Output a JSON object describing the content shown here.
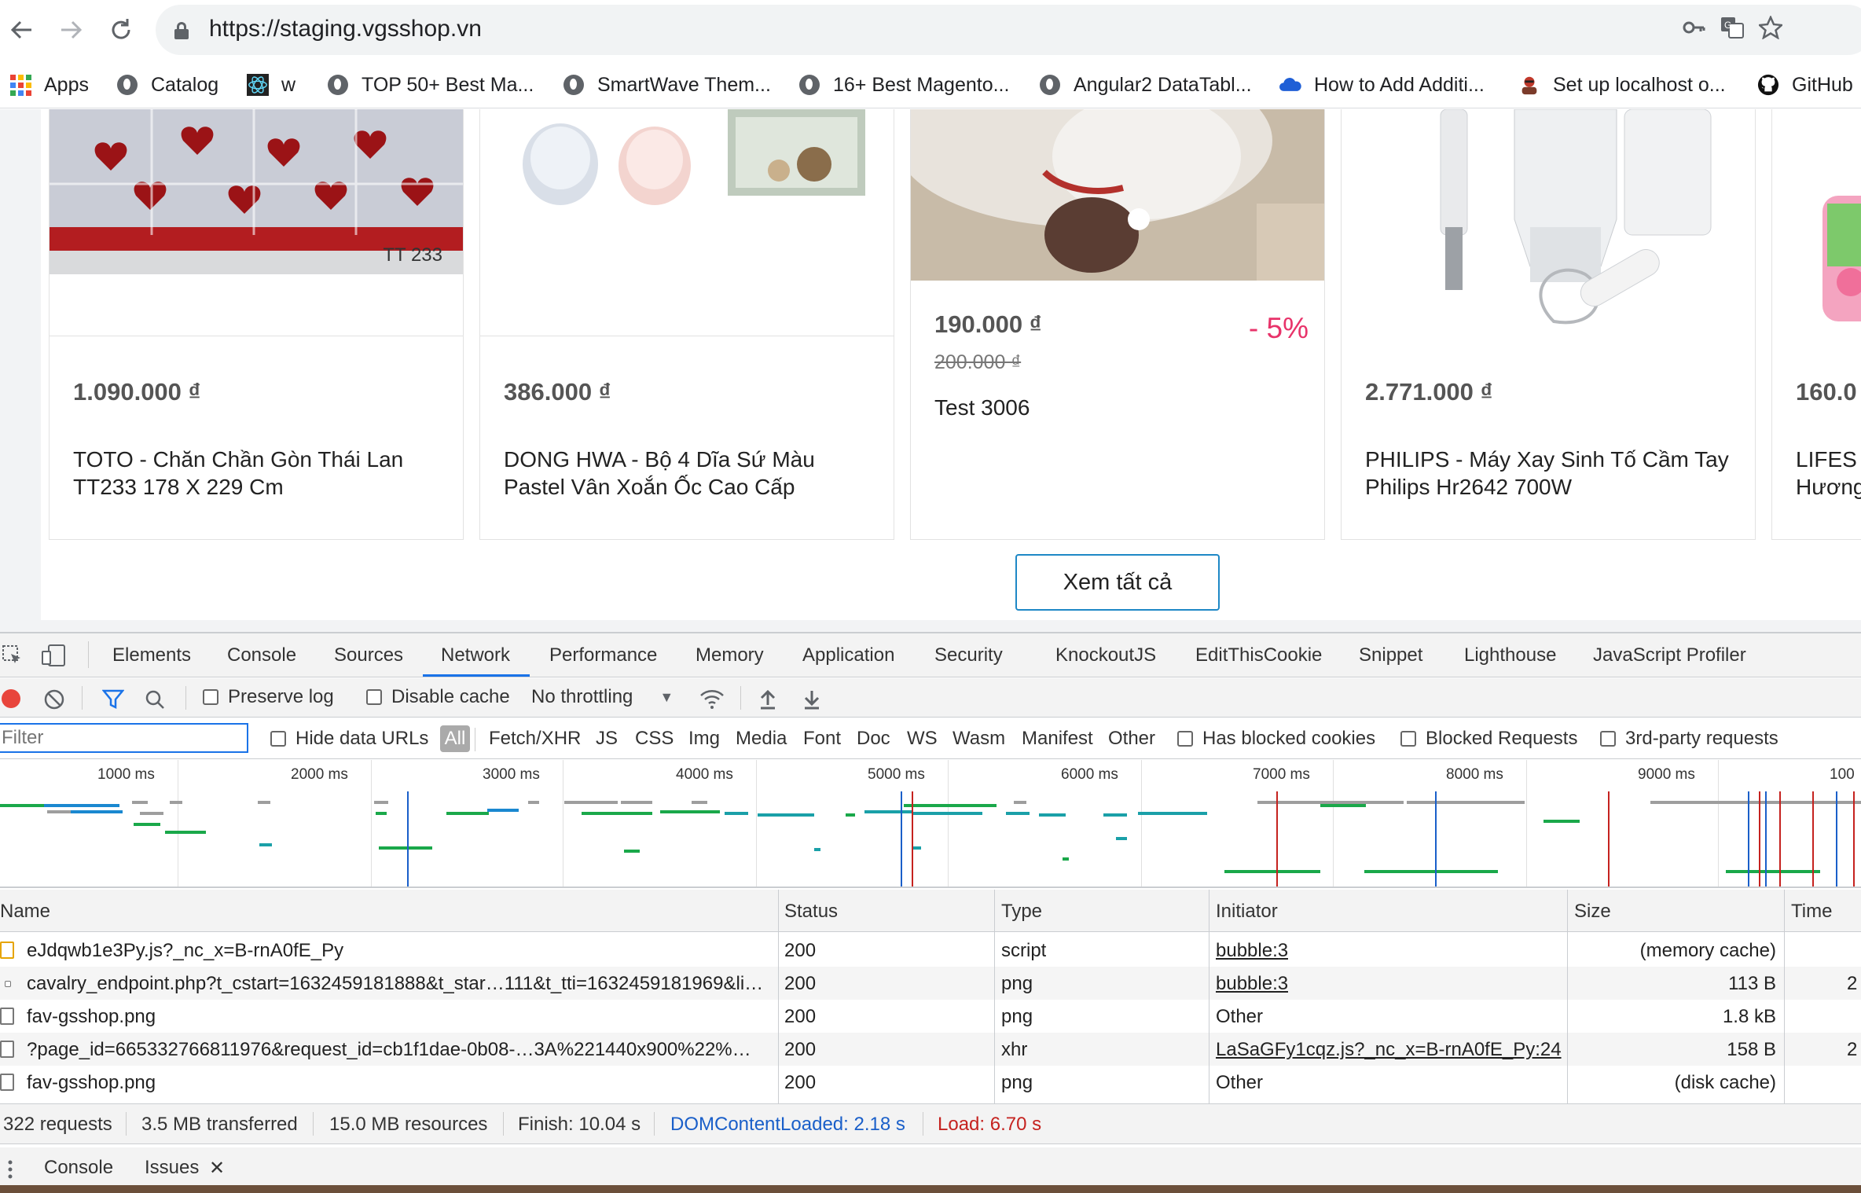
{
  "browser": {
    "url": "https://staging.vgsshop.vn",
    "bookmarks": [
      {
        "label": "Apps",
        "icon": "apps-grid-icon"
      },
      {
        "label": "Catalog",
        "icon": "globe-icon"
      },
      {
        "label": "w",
        "icon": "react-icon"
      },
      {
        "label": "TOP 50+ Best Ma...",
        "icon": "globe-icon"
      },
      {
        "label": "SmartWave Them...",
        "icon": "globe-icon"
      },
      {
        "label": "16+ Best Magento...",
        "icon": "globe-icon"
      },
      {
        "label": "Angular2 DataTabl...",
        "icon": "globe-icon"
      },
      {
        "label": "How to Add Additi...",
        "icon": "cloud-icon"
      },
      {
        "label": "Set up localhost o...",
        "icon": "avatar-icon"
      },
      {
        "label": "GitHub",
        "icon": "github-icon"
      }
    ]
  },
  "products": [
    {
      "price": "1.090.000 ₫",
      "old_price": "",
      "discount": "",
      "name": "TOTO - Chăn Chần Gòn Thái Lan TT233 178 X 229 Cm",
      "image_label": "TT 233"
    },
    {
      "price": "386.000 ₫",
      "old_price": "",
      "discount": "",
      "name": "DONG HWA - Bộ 4 Dĩa Sứ Màu Pastel Vân Xoắn Ốc Cao Cấp",
      "image_label": ""
    },
    {
      "price": "190.000 ₫",
      "old_price": "200.000 ₫",
      "discount": "- 5%",
      "name": "Test 3006",
      "image_label": ""
    },
    {
      "price": "2.771.000 ₫",
      "old_price": "",
      "discount": "",
      "name": "PHILIPS - Máy Xay Sinh Tố Cầm Tay Philips Hr2642 700W",
      "image_label": ""
    },
    {
      "price": "160.0",
      "old_price": "",
      "discount": "",
      "name": "LIFES Hương",
      "image_label": ""
    }
  ],
  "see_all_label": "Xem tất cả",
  "devtools": {
    "tabs": [
      "Elements",
      "Console",
      "Sources",
      "Network",
      "Performance",
      "Memory",
      "Application",
      "Security",
      "KnockoutJS",
      "EditThisCookie",
      "Snippet",
      "Lighthouse",
      "JavaScript Profiler"
    ],
    "active_tab": "Network",
    "network_toolbar": {
      "preserve_log": "Preserve log",
      "disable_cache": "Disable cache",
      "throttling": "No throttling"
    },
    "filter": {
      "placeholder": "Filter",
      "hide_data_urls": "Hide data URLs",
      "types": [
        "All",
        "Fetch/XHR",
        "JS",
        "CSS",
        "Img",
        "Media",
        "Font",
        "Doc",
        "WS",
        "Wasm",
        "Manifest",
        "Other"
      ],
      "has_blocked_cookies": "Has blocked cookies",
      "blocked_requests": "Blocked Requests",
      "third_party": "3rd-party requests"
    },
    "timeline_ticks": [
      "1000 ms",
      "2000 ms",
      "3000 ms",
      "4000 ms",
      "5000 ms",
      "6000 ms",
      "7000 ms",
      "8000 ms",
      "9000 ms",
      "100"
    ],
    "columns": [
      "Name",
      "Status",
      "Type",
      "Initiator",
      "Size",
      "Time"
    ],
    "rows": [
      {
        "name": "eJdqwb1e3Py.js?_nc_x=B-rnA0fE_Py",
        "status": "200",
        "type": "script",
        "initiator": "bubble:3",
        "initiator_link": true,
        "size": "(memory cache)",
        "time": ""
      },
      {
        "name": "cavalry_endpoint.php?t_cstart=1632459181888&t_star…111&t_tti=1632459181969&li…",
        "status": "200",
        "type": "png",
        "initiator": "bubble:3",
        "initiator_link": true,
        "size": "113 B",
        "time": "2"
      },
      {
        "name": "fav-gsshop.png",
        "status": "200",
        "type": "png",
        "initiator": "Other",
        "initiator_link": false,
        "size": "1.8 kB",
        "time": ""
      },
      {
        "name": "?page_id=665332766811976&request_id=cb1f1dae-0b08-…3A%221440x900%22%…",
        "status": "200",
        "type": "xhr",
        "initiator": "LaSaGFy1cqz.js?_nc_x=B-rnA0fE_Py:24",
        "initiator_link": true,
        "size": "158 B",
        "time": "2"
      },
      {
        "name": "fav-gsshop.png",
        "status": "200",
        "type": "png",
        "initiator": "Other",
        "initiator_link": false,
        "size": "(disk cache)",
        "time": ""
      }
    ],
    "summary": {
      "requests": "322 requests",
      "transferred": "3.5 MB transferred",
      "resources": "15.0 MB resources",
      "finish": "Finish: 10.04 s",
      "dom_content_loaded": "DOMContentLoaded: 2.18 s",
      "load": "Load: 6.70 s"
    },
    "drawer_tabs": [
      "Console",
      "Issues"
    ],
    "drawer_active": "Issues"
  },
  "colors": {
    "accent_blue": "#1a73e8",
    "discount": "#e8336a",
    "dcl_blue": "#1a5fc9",
    "load_red": "#c5221f",
    "see_all_border": "#1e88c6"
  }
}
